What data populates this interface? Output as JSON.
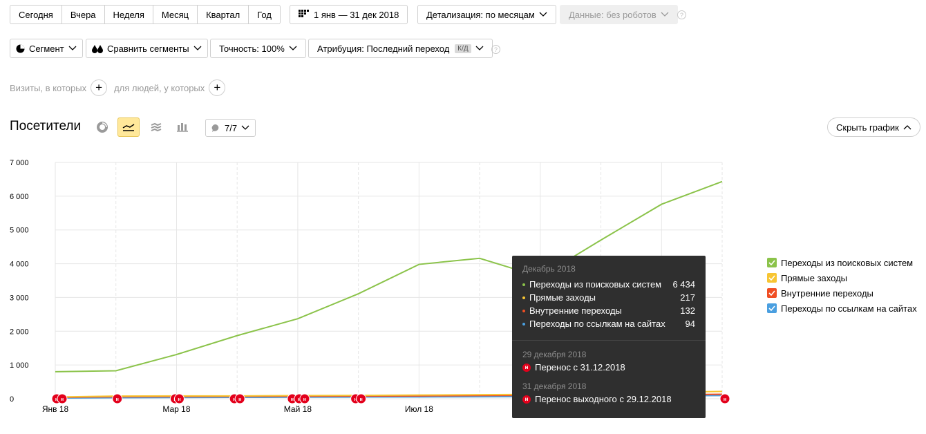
{
  "periods": [
    "Сегодня",
    "Вчера",
    "Неделя",
    "Месяц",
    "Квартал",
    "Год"
  ],
  "date_range": "1 янв — 31 дек 2018",
  "detail": "Детализация: по месяцам",
  "data_filter": "Данные: без роботов",
  "segment": "Сегмент",
  "compare": "Сравнить сегменты",
  "accuracy": "Точность: 100%",
  "attribution": "Атрибуция: Последний переход",
  "attribution_tag": "К/Д",
  "visits_label": "Визиты, в которых",
  "people_label": "для людей, у которых",
  "section_title": "Посетители",
  "notes_count": "7/7",
  "hide_chart": "Скрыть график",
  "legend": [
    {
      "label": "Переходы из поисковых систем",
      "color": "#8bc34a"
    },
    {
      "label": "Прямые заходы",
      "color": "#f7c533"
    },
    {
      "label": "Внутренние переходы",
      "color": "#f04e23"
    },
    {
      "label": "Переходы по ссылкам на сайтах",
      "color": "#4a9fe0"
    }
  ],
  "tooltip": {
    "month": "Декабрь 2018",
    "rows": [
      {
        "label": "Переходы из поисковых систем",
        "value": "6 434",
        "color": "#8bc34a"
      },
      {
        "label": "Прямые заходы",
        "value": "217",
        "color": "#f7c533"
      },
      {
        "label": "Внутренние переходы",
        "value": "132",
        "color": "#f04e23"
      },
      {
        "label": "Переходы по ссылкам на сайтах",
        "value": "94",
        "color": "#4a9fe0"
      }
    ],
    "holidays": [
      {
        "date": "29 декабря 2018",
        "text": "Перенос с 31.12.2018"
      },
      {
        "date": "31 декабря 2018",
        "text": "Перенос выходного с 29.12.2018"
      }
    ],
    "holiday_badge": "н"
  },
  "chart_data": {
    "type": "line",
    "x": [
      0,
      1,
      2,
      3,
      4,
      5,
      6,
      7,
      8,
      9,
      10,
      11
    ],
    "x_tick_labels": [
      {
        "at": 0,
        "label": "Янв 18"
      },
      {
        "at": 2,
        "label": "Мар 18"
      },
      {
        "at": 4,
        "label": "Май 18"
      },
      {
        "at": 6,
        "label": "Июл 18"
      }
    ],
    "y_ticks": [
      "0",
      "1 000",
      "2 000",
      "3 000",
      "4 000",
      "5 000",
      "6 000",
      "7 000"
    ],
    "ylim": [
      0,
      7000
    ],
    "series": [
      {
        "name": "Переходы из поисковых систем",
        "color": "#8bc34a",
        "values": [
          800,
          830,
          1310,
          1870,
          2370,
          3110,
          3980,
          4160,
          3610,
          4700,
          5760,
          6434
        ]
      },
      {
        "name": "Прямые заходы",
        "color": "#f7c533",
        "values": [
          50,
          80,
          85,
          85,
          95,
          100,
          110,
          120,
          130,
          160,
          190,
          217
        ]
      },
      {
        "name": "Внутренние переходы",
        "color": "#f04e23",
        "values": [
          40,
          60,
          65,
          70,
          75,
          80,
          85,
          95,
          100,
          110,
          120,
          132
        ]
      },
      {
        "name": "Переходы по ссылкам на сайтах",
        "color": "#4a9fe0",
        "values": [
          20,
          30,
          35,
          40,
          45,
          50,
          55,
          60,
          65,
          75,
          85,
          94
        ]
      }
    ],
    "grid": true,
    "legend_position": "right"
  }
}
